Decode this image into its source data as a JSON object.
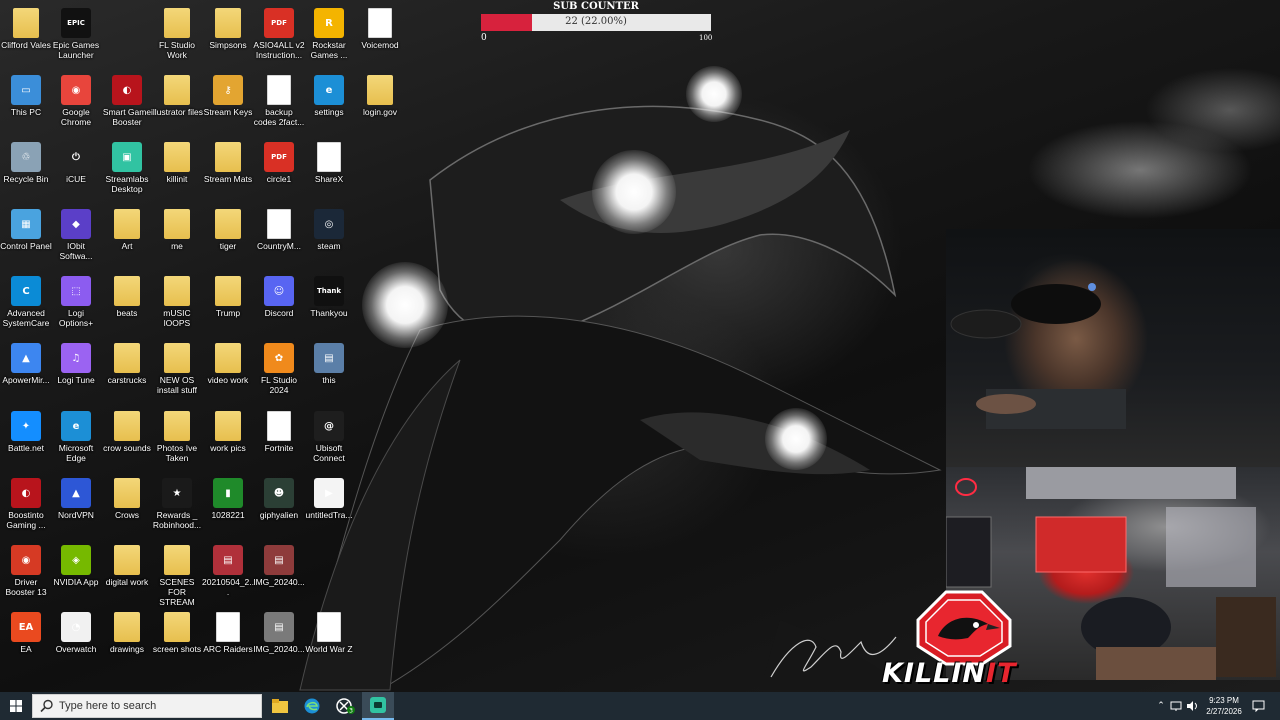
{
  "desktop": {
    "icons": [
      {
        "label": "Clifford Vales",
        "icon": "folder-user-icon",
        "kind": "folder"
      },
      {
        "label": "Epic Games Launcher",
        "icon": "epic-games-icon",
        "kind": "app",
        "color": "#111111",
        "glyph": "EPIC"
      },
      {
        "label": "FL Studio Work",
        "icon": "folder-icon",
        "kind": "folder"
      },
      {
        "label": "Simpsons",
        "icon": "folder-icon",
        "kind": "folder"
      },
      {
        "label": "ASIO4ALL v2 Instruction...",
        "icon": "pdf-icon",
        "kind": "app",
        "color": "#d93025",
        "glyph": "PDF"
      },
      {
        "label": "Rockstar Games ...",
        "icon": "rockstar-icon",
        "kind": "app",
        "color": "#f4b400",
        "glyph": "R"
      },
      {
        "label": "Voicemod",
        "icon": "file-icon",
        "kind": "doc"
      },
      {
        "label": "This PC",
        "icon": "computer-icon",
        "kind": "app",
        "color": "#3b8ed9",
        "glyph": "▭"
      },
      {
        "label": "Google Chrome",
        "icon": "chrome-icon",
        "kind": "app",
        "color": "#e8453c",
        "glyph": "◉"
      },
      {
        "label": "Smart Game Booster",
        "icon": "game-booster-icon",
        "kind": "app",
        "color": "#b8141c",
        "glyph": "◐"
      },
      {
        "label": "illustrator files",
        "icon": "folder-icon",
        "kind": "folder"
      },
      {
        "label": "Stream Keys",
        "icon": "key-icon",
        "kind": "app",
        "color": "#e3a531",
        "glyph": "⚷"
      },
      {
        "label": "backup codes 2fact...",
        "icon": "file-icon",
        "kind": "doc"
      },
      {
        "label": "settings",
        "icon": "edge-icon",
        "kind": "app",
        "color": "#1c8fd6",
        "glyph": "e"
      },
      {
        "label": "login.gov",
        "icon": "folder-icon",
        "kind": "folder"
      },
      {
        "label": "Recycle Bin",
        "icon": "recycle-bin-icon",
        "kind": "app",
        "color": "#8aa2b5",
        "glyph": "♲"
      },
      {
        "label": "iCUE",
        "icon": "icue-icon",
        "kind": "app",
        "color": "#222222",
        "glyph": "⏻"
      },
      {
        "label": "Streamlabs Desktop",
        "icon": "streamlabs-icon",
        "kind": "app",
        "color": "#31c3a2",
        "glyph": "▣"
      },
      {
        "label": "killinit",
        "icon": "folder-icon",
        "kind": "folder"
      },
      {
        "label": "Stream Mats",
        "icon": "folder-icon",
        "kind": "folder"
      },
      {
        "label": "circle1",
        "icon": "pdf-icon",
        "kind": "app",
        "color": "#d93025",
        "glyph": "PDF"
      },
      {
        "label": "ShareX",
        "icon": "file-icon",
        "kind": "doc"
      },
      {
        "label": "Control Panel",
        "icon": "control-panel-icon",
        "kind": "app",
        "color": "#4aa3df",
        "glyph": "▦"
      },
      {
        "label": "IObit Softwa...",
        "icon": "iobit-icon",
        "kind": "app",
        "color": "#5b3fc8",
        "glyph": "◆"
      },
      {
        "label": "Art",
        "icon": "folder-icon",
        "kind": "folder"
      },
      {
        "label": "me",
        "icon": "folder-icon",
        "kind": "folder"
      },
      {
        "label": "tiger",
        "icon": "folder-icon",
        "kind": "folder"
      },
      {
        "label": "CountryM...",
        "icon": "file-icon",
        "kind": "doc"
      },
      {
        "label": "steam",
        "icon": "steam-icon",
        "kind": "app",
        "color": "#1b2838",
        "glyph": "◎"
      },
      {
        "label": "Advanced SystemCare",
        "icon": "systemcare-icon",
        "kind": "app",
        "color": "#0b8bd6",
        "glyph": "C"
      },
      {
        "label": "Logi Options+",
        "icon": "logi-options-icon",
        "kind": "app",
        "color": "#8c5cf0",
        "glyph": "⬚"
      },
      {
        "label": "beats",
        "icon": "folder-icon",
        "kind": "folder"
      },
      {
        "label": "mUSIC lOOPS",
        "icon": "folder-icon",
        "kind": "folder"
      },
      {
        "label": "Trump",
        "icon": "folder-icon",
        "kind": "folder"
      },
      {
        "label": "Discord",
        "icon": "discord-icon",
        "kind": "app",
        "color": "#5865f2",
        "glyph": "☺"
      },
      {
        "label": "Thankyou",
        "icon": "thankyou-image-icon",
        "kind": "app",
        "color": "#101010",
        "glyph": "Thank"
      },
      {
        "label": "ApowerMir...",
        "icon": "apowermirror-icon",
        "kind": "app",
        "color": "#3d86f0",
        "glyph": "▲"
      },
      {
        "label": "Logi Tune",
        "icon": "logi-tune-icon",
        "kind": "app",
        "color": "#9b63f2",
        "glyph": "♫"
      },
      {
        "label": "carstrucks",
        "icon": "folder-icon",
        "kind": "folder"
      },
      {
        "label": "NEW OS install stuff",
        "icon": "folder-icon",
        "kind": "folder"
      },
      {
        "label": "video work",
        "icon": "folder-icon",
        "kind": "folder"
      },
      {
        "label": "FL Studio 2024",
        "icon": "fl-studio-icon",
        "kind": "app",
        "color": "#f08a1c",
        "glyph": "✿"
      },
      {
        "label": "this",
        "icon": "image-icon",
        "kind": "app",
        "color": "#5b7fa8",
        "glyph": "▤"
      },
      {
        "label": "Battle.net",
        "icon": "battlenet-icon",
        "kind": "app",
        "color": "#148eff",
        "glyph": "✦"
      },
      {
        "label": "Microsoft Edge",
        "icon": "edge-icon",
        "kind": "app",
        "color": "#1c8fd6",
        "glyph": "e"
      },
      {
        "label": "crow sounds",
        "icon": "folder-icon",
        "kind": "folder"
      },
      {
        "label": "Photos Ive Taken",
        "icon": "folder-icon",
        "kind": "folder"
      },
      {
        "label": "work pics",
        "icon": "folder-icon",
        "kind": "folder"
      },
      {
        "label": "Fortnite",
        "icon": "file-icon",
        "kind": "doc"
      },
      {
        "label": "Ubisoft Connect",
        "icon": "ubisoft-icon",
        "kind": "app",
        "color": "#1e1e1e",
        "glyph": "@"
      },
      {
        "label": "Boostinto Gaming ...",
        "icon": "boost-gaming-icon",
        "kind": "app",
        "color": "#b8141c",
        "glyph": "◐"
      },
      {
        "label": "NordVPN",
        "icon": "nordvpn-icon",
        "kind": "app",
        "color": "#2d57d6",
        "glyph": "▲"
      },
      {
        "label": "Crows",
        "icon": "folder-icon",
        "kind": "folder"
      },
      {
        "label": "Rewards _ Robinhood...",
        "icon": "rewards-star-icon",
        "kind": "app",
        "color": "#1a1a1a",
        "glyph": "★"
      },
      {
        "label": "1028221",
        "icon": "image-icon",
        "kind": "app",
        "color": "#1f8a2a",
        "glyph": "▮"
      },
      {
        "label": "giphyalien",
        "icon": "alien-image-icon",
        "kind": "app",
        "color": "#2b3f35",
        "glyph": "☻"
      },
      {
        "label": "untitledTra...",
        "icon": "video-file-icon",
        "kind": "app",
        "color": "#f4f4f4",
        "glyph": "▶"
      },
      {
        "label": "Driver Booster 13",
        "icon": "driver-booster-icon",
        "kind": "app",
        "color": "#d63a24",
        "glyph": "◉"
      },
      {
        "label": "NVIDIA App",
        "icon": "nvidia-icon",
        "kind": "app",
        "color": "#76b900",
        "glyph": "◈"
      },
      {
        "label": "digital work",
        "icon": "folder-icon",
        "kind": "folder"
      },
      {
        "label": "SCENES FOR STREAM",
        "icon": "folder-icon",
        "kind": "folder"
      },
      {
        "label": "20210504_2...",
        "icon": "image-icon",
        "kind": "app",
        "color": "#b0303a",
        "glyph": "▤"
      },
      {
        "label": "IMG_20240...",
        "icon": "image-icon",
        "kind": "app",
        "color": "#8e3b3b",
        "glyph": "▤"
      },
      {
        "label": "EA",
        "icon": "ea-icon",
        "kind": "app",
        "color": "#ea4a1f",
        "glyph": "EA"
      },
      {
        "label": "Overwatch",
        "icon": "overwatch-icon",
        "kind": "app",
        "color": "#f1f1f1",
        "glyph": "◔"
      },
      {
        "label": "drawings",
        "icon": "folder-icon",
        "kind": "folder"
      },
      {
        "label": "screen shots",
        "icon": "folder-icon",
        "kind": "folder"
      },
      {
        "label": "ARC Raiders",
        "icon": "file-icon",
        "kind": "doc"
      },
      {
        "label": "IMG_20240...",
        "icon": "image-icon",
        "kind": "app",
        "color": "#7a7a7a",
        "glyph": "▤"
      },
      {
        "label": "World War Z",
        "icon": "file-icon",
        "kind": "doc"
      }
    ]
  },
  "sub_counter": {
    "title": "SUB COUNTER",
    "value_text": "22 (22.00%)",
    "progress": 0.22,
    "min_label": "0",
    "max_label": "100",
    "fill_color": "#d7223d"
  },
  "overlay": {
    "logo_text_main": "KILLIN",
    "logo_text_accent": "IT"
  },
  "taskbar": {
    "search_placeholder": "Type here to search",
    "apps": [
      "file-explorer-icon",
      "edge-icon",
      "xbox-icon",
      "streamlabs-icon"
    ],
    "xbox_badge": "3",
    "clock_time": "9:23 PM",
    "clock_date": "2/27/2026"
  }
}
